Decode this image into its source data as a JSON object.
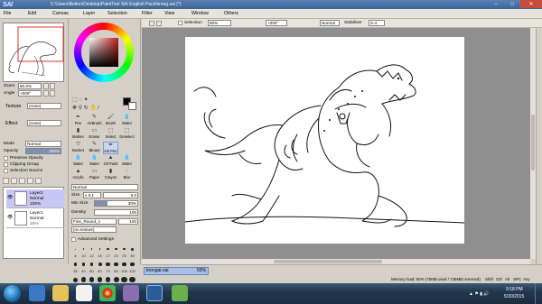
{
  "app": {
    "logo": "SAI",
    "title": "C:\\Users\\Belinn\\Desktop\\PaintTool SAI English Pack\\kroog.sai (*)",
    "window_controls": [
      "–",
      "□",
      "✕"
    ]
  },
  "menu": [
    "File",
    "Edit",
    "Canvas",
    "Layer",
    "Selection",
    "Filter",
    "View",
    "Window",
    "Others"
  ],
  "canvas_toolbar": {
    "selection_label": "Selection",
    "zoom": "50%",
    "angle": "+000°",
    "blend": "Normal",
    "stabilizer_label": "Stabilizer",
    "stabilizer": "S-4"
  },
  "navigator": {
    "zoom_label": "Zoom",
    "zoom_value": "50.0%",
    "angle_label": "Angle",
    "angle_value": "+000°"
  },
  "layer_props": {
    "texture_label": "Texture",
    "texture_value": "(none)",
    "effect_label": "Effect",
    "effect_value": "(none)",
    "mode_label": "Mode",
    "mode_value": "Normal",
    "opacity_label": "Opacity",
    "opacity_value": "100%",
    "checks": [
      "Preserve Opacity",
      "Clipping Group",
      "Selection Source"
    ]
  },
  "layers": [
    {
      "name": "Layer2",
      "mode": "Normal",
      "opacity": "100%",
      "selected": true
    },
    {
      "name": "Layer1",
      "mode": "Normal",
      "opacity": "34%",
      "selected": false
    }
  ],
  "tools": [
    {
      "label": "Pen",
      "icon": "✒"
    },
    {
      "label": "AirBrush",
      "icon": "✎"
    },
    {
      "label": "Brush",
      "icon": "🖌"
    },
    {
      "label": "Water",
      "icon": "💧"
    },
    {
      "label": "Marker",
      "icon": "▮"
    },
    {
      "label": "Eraser",
      "icon": "▭"
    },
    {
      "label": "Select",
      "icon": "⬚"
    },
    {
      "label": "Deselect",
      "icon": "⬚"
    },
    {
      "label": "Bucket",
      "icon": "▽"
    },
    {
      "label": "Binary",
      "icon": "✎"
    },
    {
      "label": "Ink Pen",
      "icon": "✒"
    },
    {
      "label": "",
      "icon": ""
    },
    {
      "label": "Water",
      "icon": "💧"
    },
    {
      "label": "Water",
      "icon": "💧"
    },
    {
      "label": "Oil Paint",
      "icon": "▲"
    },
    {
      "label": "Water",
      "icon": "💧"
    },
    {
      "label": "Acrylic",
      "icon": "▲"
    },
    {
      "label": "Paper",
      "icon": "▭"
    },
    {
      "label": "Crayon",
      "icon": "▮"
    },
    {
      "label": "Blur",
      "icon": "◌"
    }
  ],
  "brush": {
    "blend": "Normal",
    "size_label": "Size",
    "size_mult": "x 0.1",
    "size_value": "5.0",
    "minsize_label": "Min Size",
    "minsize_value": "30%",
    "density_label": "Density",
    "density_value": "100",
    "shape": "Fine_Round_1",
    "shape_value": "100",
    "texture": "(no texture)",
    "advanced": "Advanced Settings",
    "presets": [
      "8",
      "10",
      "12",
      "15",
      "17",
      "20",
      "25",
      "30",
      "35",
      "40",
      "50",
      "60",
      "70",
      "80",
      "100",
      "120",
      "150",
      "170",
      "200",
      "250",
      "300",
      "350",
      "400",
      "450"
    ]
  },
  "canvas_tab": {
    "name": "kroogar.sai",
    "zoom": "50%"
  },
  "status": "Memory load: 50% (75MB used / 735MB reserved)",
  "status_keys": [
    "Shift",
    "Ctrl",
    "Alt",
    "SPC",
    "Any"
  ],
  "taskbar": {
    "time": "9:18 PM",
    "date": "5/30/2015"
  },
  "colors": {
    "accent": "#3f6398",
    "selection": "#c8c6f4"
  }
}
